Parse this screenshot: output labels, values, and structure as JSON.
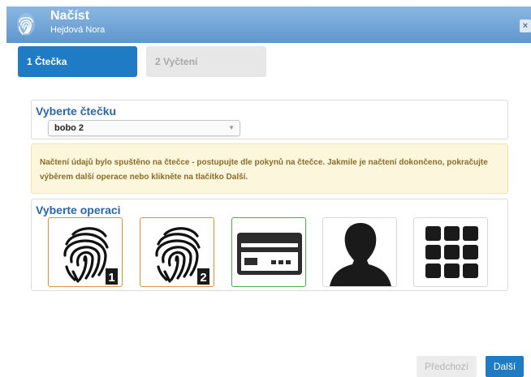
{
  "window": {
    "title": "Načíst",
    "subtitle": "Hejdová Nora",
    "close_label": "×"
  },
  "steps": [
    {
      "label": "1 Čtečka",
      "active": true
    },
    {
      "label": "2 Vyčtení",
      "active": false
    }
  ],
  "reader": {
    "heading": "Vyberte čtečku",
    "selected": "bobo 2"
  },
  "alert": {
    "text": "Načtení údajů bylo spuštěno na čtečce - postupujte dle pokynů na čtečce. Jakmile je načtení dokončeno, pokračujte výběrem další operace nebo klikněte na tlačítko Další."
  },
  "operations": {
    "heading": "Vyberte operaci",
    "items": [
      {
        "icon": "fingerprint-1-icon",
        "badge": "1",
        "border": "#e0903a"
      },
      {
        "icon": "fingerprint-2-icon",
        "badge": "2",
        "border": "#e0903a"
      },
      {
        "icon": "id-card-icon",
        "border": "#4cae4c"
      },
      {
        "icon": "person-silhouette-icon",
        "border": "#d8d8d8"
      },
      {
        "icon": "grid-icon",
        "border": "#d8d8d8"
      }
    ]
  },
  "footer": {
    "prev_label": "Předchozí",
    "next_label": "Další"
  },
  "colors": {
    "accent": "#1f7bc4",
    "titlebar": "#6fa3d6",
    "alert_bg": "#fcf6dc"
  }
}
